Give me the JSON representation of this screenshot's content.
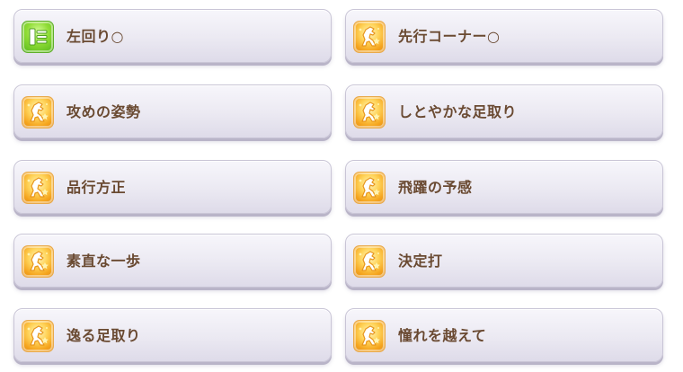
{
  "skills": [
    {
      "name": "左回り○",
      "icon": "track-direction-icon"
    },
    {
      "name": "先行コーナー○",
      "icon": "horse-speed-icon"
    },
    {
      "name": "攻めの姿勢",
      "icon": "horse-speed-icon"
    },
    {
      "name": "しとやかな足取り",
      "icon": "horse-speed-icon"
    },
    {
      "name": "品行方正",
      "icon": "horse-speed-icon"
    },
    {
      "name": "飛躍の予感",
      "icon": "horse-speed-icon"
    },
    {
      "name": "素直な一歩",
      "icon": "horse-speed-icon"
    },
    {
      "name": "決定打",
      "icon": "horse-speed-icon"
    },
    {
      "name": "逸る足取り",
      "icon": "horse-speed-icon"
    },
    {
      "name": "憧れを越えて",
      "icon": "horse-speed-icon"
    }
  ],
  "colors": {
    "card_background": "#ebe9f2",
    "text": "#6a4a32",
    "gold_icon": "#f5a51f",
    "green_icon": "#8fdc35"
  }
}
